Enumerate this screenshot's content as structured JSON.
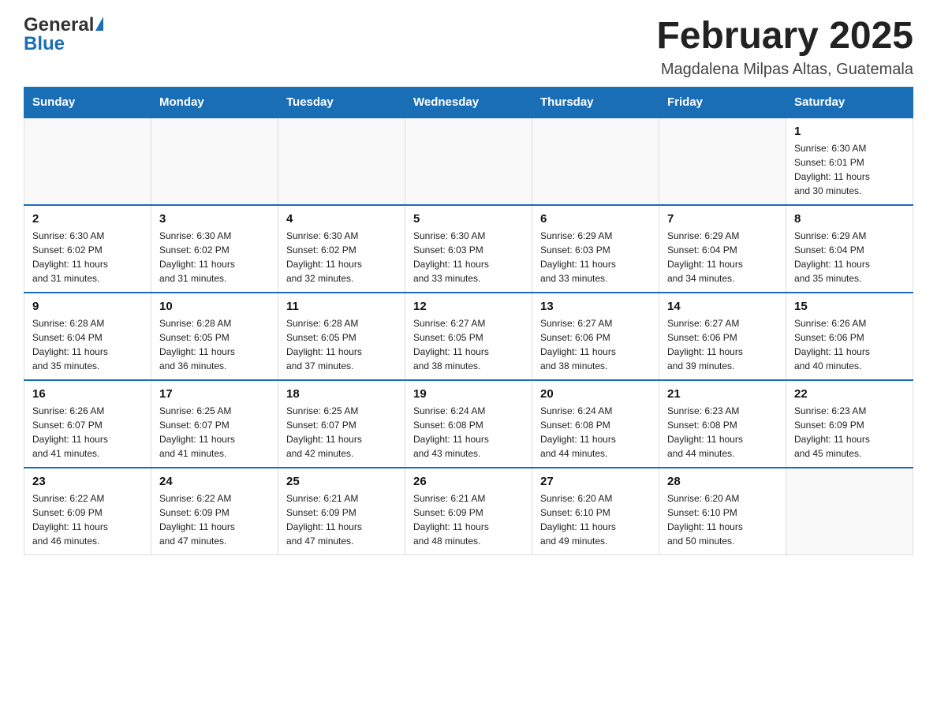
{
  "header": {
    "logo_general": "General",
    "logo_blue": "Blue",
    "month_title": "February 2025",
    "location": "Magdalena Milpas Altas, Guatemala"
  },
  "days_of_week": [
    "Sunday",
    "Monday",
    "Tuesday",
    "Wednesday",
    "Thursday",
    "Friday",
    "Saturday"
  ],
  "weeks": [
    [
      {
        "day": "",
        "info": ""
      },
      {
        "day": "",
        "info": ""
      },
      {
        "day": "",
        "info": ""
      },
      {
        "day": "",
        "info": ""
      },
      {
        "day": "",
        "info": ""
      },
      {
        "day": "",
        "info": ""
      },
      {
        "day": "1",
        "info": "Sunrise: 6:30 AM\nSunset: 6:01 PM\nDaylight: 11 hours\nand 30 minutes."
      }
    ],
    [
      {
        "day": "2",
        "info": "Sunrise: 6:30 AM\nSunset: 6:02 PM\nDaylight: 11 hours\nand 31 minutes."
      },
      {
        "day": "3",
        "info": "Sunrise: 6:30 AM\nSunset: 6:02 PM\nDaylight: 11 hours\nand 31 minutes."
      },
      {
        "day": "4",
        "info": "Sunrise: 6:30 AM\nSunset: 6:02 PM\nDaylight: 11 hours\nand 32 minutes."
      },
      {
        "day": "5",
        "info": "Sunrise: 6:30 AM\nSunset: 6:03 PM\nDaylight: 11 hours\nand 33 minutes."
      },
      {
        "day": "6",
        "info": "Sunrise: 6:29 AM\nSunset: 6:03 PM\nDaylight: 11 hours\nand 33 minutes."
      },
      {
        "day": "7",
        "info": "Sunrise: 6:29 AM\nSunset: 6:04 PM\nDaylight: 11 hours\nand 34 minutes."
      },
      {
        "day": "8",
        "info": "Sunrise: 6:29 AM\nSunset: 6:04 PM\nDaylight: 11 hours\nand 35 minutes."
      }
    ],
    [
      {
        "day": "9",
        "info": "Sunrise: 6:28 AM\nSunset: 6:04 PM\nDaylight: 11 hours\nand 35 minutes."
      },
      {
        "day": "10",
        "info": "Sunrise: 6:28 AM\nSunset: 6:05 PM\nDaylight: 11 hours\nand 36 minutes."
      },
      {
        "day": "11",
        "info": "Sunrise: 6:28 AM\nSunset: 6:05 PM\nDaylight: 11 hours\nand 37 minutes."
      },
      {
        "day": "12",
        "info": "Sunrise: 6:27 AM\nSunset: 6:05 PM\nDaylight: 11 hours\nand 38 minutes."
      },
      {
        "day": "13",
        "info": "Sunrise: 6:27 AM\nSunset: 6:06 PM\nDaylight: 11 hours\nand 38 minutes."
      },
      {
        "day": "14",
        "info": "Sunrise: 6:27 AM\nSunset: 6:06 PM\nDaylight: 11 hours\nand 39 minutes."
      },
      {
        "day": "15",
        "info": "Sunrise: 6:26 AM\nSunset: 6:06 PM\nDaylight: 11 hours\nand 40 minutes."
      }
    ],
    [
      {
        "day": "16",
        "info": "Sunrise: 6:26 AM\nSunset: 6:07 PM\nDaylight: 11 hours\nand 41 minutes."
      },
      {
        "day": "17",
        "info": "Sunrise: 6:25 AM\nSunset: 6:07 PM\nDaylight: 11 hours\nand 41 minutes."
      },
      {
        "day": "18",
        "info": "Sunrise: 6:25 AM\nSunset: 6:07 PM\nDaylight: 11 hours\nand 42 minutes."
      },
      {
        "day": "19",
        "info": "Sunrise: 6:24 AM\nSunset: 6:08 PM\nDaylight: 11 hours\nand 43 minutes."
      },
      {
        "day": "20",
        "info": "Sunrise: 6:24 AM\nSunset: 6:08 PM\nDaylight: 11 hours\nand 44 minutes."
      },
      {
        "day": "21",
        "info": "Sunrise: 6:23 AM\nSunset: 6:08 PM\nDaylight: 11 hours\nand 44 minutes."
      },
      {
        "day": "22",
        "info": "Sunrise: 6:23 AM\nSunset: 6:09 PM\nDaylight: 11 hours\nand 45 minutes."
      }
    ],
    [
      {
        "day": "23",
        "info": "Sunrise: 6:22 AM\nSunset: 6:09 PM\nDaylight: 11 hours\nand 46 minutes."
      },
      {
        "day": "24",
        "info": "Sunrise: 6:22 AM\nSunset: 6:09 PM\nDaylight: 11 hours\nand 47 minutes."
      },
      {
        "day": "25",
        "info": "Sunrise: 6:21 AM\nSunset: 6:09 PM\nDaylight: 11 hours\nand 47 minutes."
      },
      {
        "day": "26",
        "info": "Sunrise: 6:21 AM\nSunset: 6:09 PM\nDaylight: 11 hours\nand 48 minutes."
      },
      {
        "day": "27",
        "info": "Sunrise: 6:20 AM\nSunset: 6:10 PM\nDaylight: 11 hours\nand 49 minutes."
      },
      {
        "day": "28",
        "info": "Sunrise: 6:20 AM\nSunset: 6:10 PM\nDaylight: 11 hours\nand 50 minutes."
      },
      {
        "day": "",
        "info": ""
      }
    ]
  ]
}
